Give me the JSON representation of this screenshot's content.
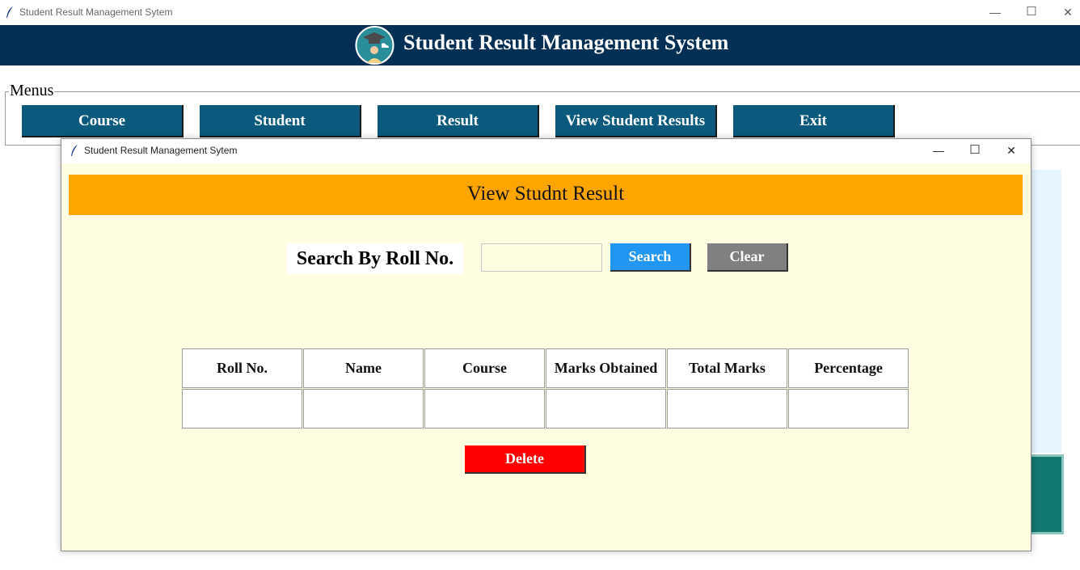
{
  "main_window": {
    "title": "Student Result Management Sytem",
    "controls": {
      "minimize": "—",
      "maximize": "☐",
      "close": "✕"
    }
  },
  "header": {
    "title": "Student Result Management System"
  },
  "menus": {
    "label": "Menus",
    "buttons": [
      "Course",
      "Student",
      "Result",
      "View Student Results",
      "Exit"
    ]
  },
  "child_window": {
    "title": "Student Result Management Sytem",
    "controls": {
      "minimize": "—",
      "maximize": "☐",
      "close": "✕"
    },
    "banner_title": "View Studnt Result",
    "search": {
      "label": "Search By Roll No.",
      "value": "",
      "search_button": "Search",
      "clear_button": "Clear"
    },
    "table": {
      "headers": [
        "Roll No.",
        "Name",
        "Course",
        "Marks Obtained",
        "Total Marks",
        "Percentage"
      ],
      "row": [
        "",
        "",
        "",
        "",
        "",
        ""
      ]
    },
    "delete_button": "Delete"
  },
  "colors": {
    "header_bg": "#033054",
    "menu_button_bg": "#0b5a7d",
    "banner_bg": "#ffa500",
    "child_bg": "#fffde1",
    "search_button_bg": "#2196f3",
    "clear_button_bg": "#808080",
    "delete_button_bg": "#ff0000"
  }
}
